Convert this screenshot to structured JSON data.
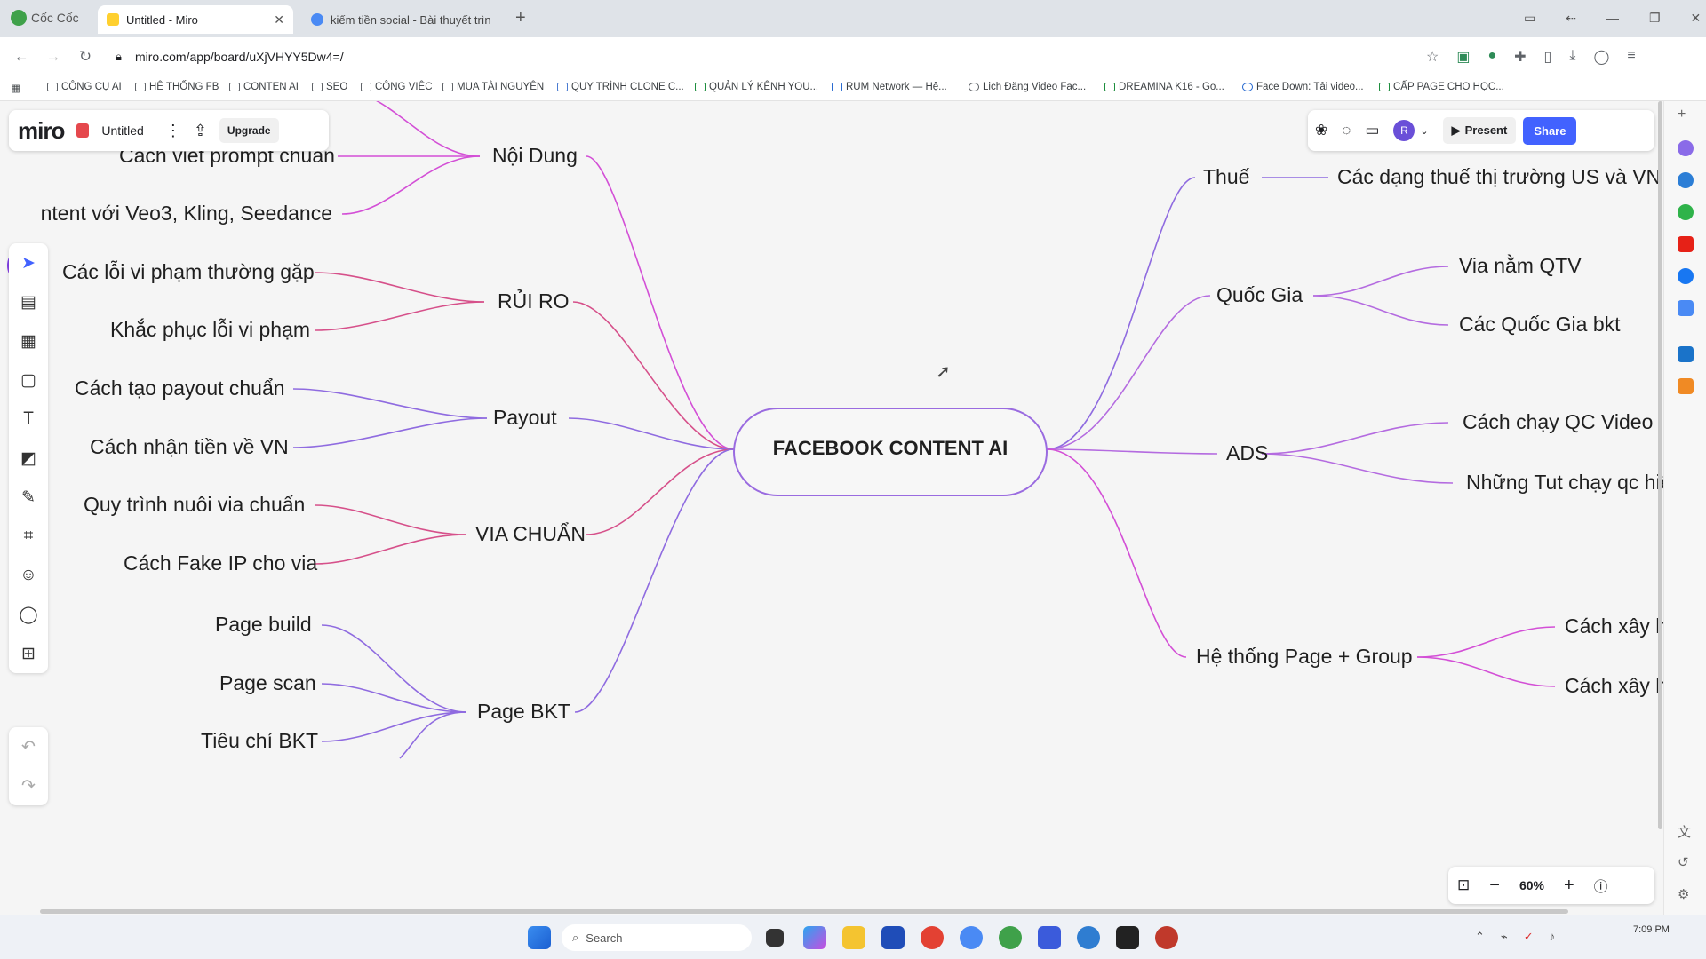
{
  "browser": {
    "brand": "Cốc Cốc",
    "tabs": [
      {
        "title": "Untitled - Miro",
        "active": true
      },
      {
        "title": "kiếm tiền social - Bài thuyết trìn",
        "active": false
      }
    ],
    "url": "miro.com/app/board/uXjVHYY5Dw4=/",
    "bookmarks": [
      "CÔNG CỤ AI",
      "HỆ THỐNG FB",
      "CONTEN AI",
      "SEO",
      "CÔNG VIỆC",
      "MUA TÀI NGUYÊN",
      "QUY TRÌNH CLONE C...",
      "QUẢN LÝ KÊNH YOU...",
      "RUM Network — Hệ...",
      "Lịch Đăng Video Fac...",
      "DREAMINA K16 - Go...",
      "Face Down: Tải video...",
      "CẤP PAGE CHO HỌC..."
    ]
  },
  "miro": {
    "logo": "miro",
    "board_name": "Untitled",
    "upgrade": "Upgrade",
    "avatar": "R",
    "present": "Present",
    "share": "Share",
    "zoom": "60%"
  },
  "mindmap": {
    "center": "FACEBOOK CONTENT AI",
    "left": [
      {
        "label": "Nội Dung",
        "children": [
          "Cách viết prompt chuẩn",
          "ntent với Veo3, Kling, Seedance"
        ]
      },
      {
        "label": "RỦI RO",
        "children": [
          "Các lỗi vi phạm thường gặp",
          "Khắc phục lỗi vi phạm"
        ]
      },
      {
        "label": "Payout",
        "children": [
          "Cách tạo payout chuẩn",
          "Cách nhận tiền về VN"
        ]
      },
      {
        "label": "VIA CHUẨN",
        "children": [
          "Quy trình nuôi via chuẩn",
          "Cách Fake IP cho via"
        ]
      },
      {
        "label": "Page BKT",
        "children": [
          "Page build",
          "Page scan",
          "Tiêu chí BKT"
        ]
      }
    ],
    "right": [
      {
        "label": "Thuế",
        "children": [
          "Các dạng thuế thị trường US và VN"
        ]
      },
      {
        "label": "Quốc Gia",
        "children": [
          "Via nằm QTV",
          "Các Quốc Gia bkt"
        ]
      },
      {
        "label": "ADS",
        "children": [
          "Cách chạy QC Video",
          "Những Tut chạy qc hiệ"
        ]
      },
      {
        "label": "Hệ thống Page + Group",
        "children": [
          "Cách xây hệ",
          "Cách xây hệ"
        ]
      }
    ]
  },
  "taskbar": {
    "search": "Search",
    "time": "7:09 PM"
  },
  "colors": {
    "purple": "#b46be0",
    "pink": "#d6508a",
    "violet": "#8f6be0",
    "magenta": "#d34fd6",
    "share": "#4262ff"
  }
}
